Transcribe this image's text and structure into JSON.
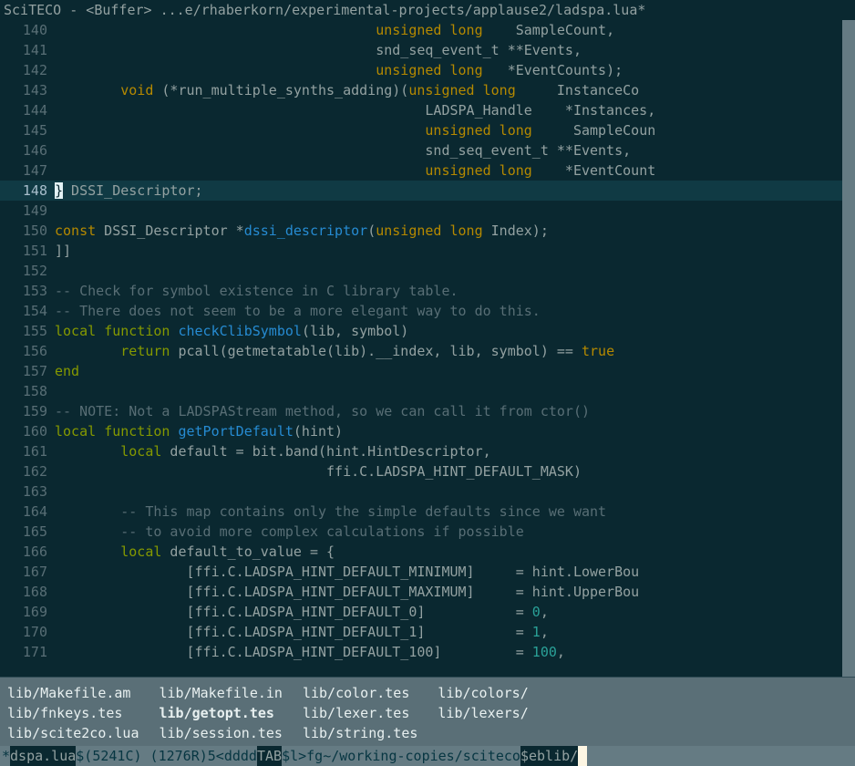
{
  "title": "SciTECO - <Buffer> ...e/rhaberkorn/experimental-projects/applause2/ladspa.lua*",
  "lines": [
    {
      "n": "140",
      "segs": [
        {
          "t": "                                       "
        },
        {
          "t": "unsigned",
          "c": "type"
        },
        {
          "t": " "
        },
        {
          "t": "long",
          "c": "type"
        },
        {
          "t": "    SampleCount,"
        }
      ]
    },
    {
      "n": "141",
      "segs": [
        {
          "t": "                                       snd_seq_event_t **Events,"
        }
      ]
    },
    {
      "n": "142",
      "segs": [
        {
          "t": "                                       "
        },
        {
          "t": "unsigned",
          "c": "type"
        },
        {
          "t": " "
        },
        {
          "t": "long",
          "c": "type"
        },
        {
          "t": "   *EventCounts);"
        }
      ]
    },
    {
      "n": "143",
      "segs": [
        {
          "t": "        "
        },
        {
          "t": "void",
          "c": "type"
        },
        {
          "t": " (*run_multiple_synths_adding)("
        },
        {
          "t": "unsigned",
          "c": "type"
        },
        {
          "t": " "
        },
        {
          "t": "long",
          "c": "type"
        },
        {
          "t": "     InstanceCo"
        }
      ]
    },
    {
      "n": "144",
      "segs": [
        {
          "t": "                                             LADSPA_Handle    *Instances,"
        }
      ]
    },
    {
      "n": "145",
      "segs": [
        {
          "t": "                                             "
        },
        {
          "t": "unsigned",
          "c": "type"
        },
        {
          "t": " "
        },
        {
          "t": "long",
          "c": "type"
        },
        {
          "t": "     SampleCoun"
        }
      ]
    },
    {
      "n": "146",
      "segs": [
        {
          "t": "                                             snd_seq_event_t **Events,"
        }
      ]
    },
    {
      "n": "147",
      "segs": [
        {
          "t": "                                             "
        },
        {
          "t": "unsigned",
          "c": "type"
        },
        {
          "t": " "
        },
        {
          "t": "long",
          "c": "type"
        },
        {
          "t": "    *EventCount"
        }
      ]
    },
    {
      "n": "148",
      "cur": true,
      "segs": [
        {
          "t": "}",
          "c": "cursor"
        },
        {
          "t": " DSSI_Descriptor;"
        }
      ]
    },
    {
      "n": "149",
      "segs": [
        {
          "t": ""
        }
      ]
    },
    {
      "n": "150",
      "segs": [
        {
          "t": "const",
          "c": "type"
        },
        {
          "t": " DSSI_Descriptor *"
        },
        {
          "t": "dssi_descriptor",
          "c": "func"
        },
        {
          "t": "("
        },
        {
          "t": "unsigned",
          "c": "type"
        },
        {
          "t": " "
        },
        {
          "t": "long",
          "c": "type"
        },
        {
          "t": " Index);"
        }
      ]
    },
    {
      "n": "151",
      "segs": [
        {
          "t": "]]"
        }
      ]
    },
    {
      "n": "152",
      "segs": [
        {
          "t": ""
        }
      ]
    },
    {
      "n": "153",
      "segs": [
        {
          "t": "-- Check for symbol existence in C library table.",
          "c": "comment"
        }
      ]
    },
    {
      "n": "154",
      "segs": [
        {
          "t": "-- There does not seem to be a more elegant way to do this.",
          "c": "comment"
        }
      ]
    },
    {
      "n": "155",
      "segs": [
        {
          "t": "local",
          "c": "kw"
        },
        {
          "t": " "
        },
        {
          "t": "function",
          "c": "kw"
        },
        {
          "t": " "
        },
        {
          "t": "checkClibSymbol",
          "c": "func"
        },
        {
          "t": "(lib, symbol)"
        }
      ]
    },
    {
      "n": "156",
      "segs": [
        {
          "t": "        "
        },
        {
          "t": "return",
          "c": "kw"
        },
        {
          "t": " pcall(getmetatable(lib).__index, lib, symbol) == "
        },
        {
          "t": "true",
          "c": "bool"
        }
      ]
    },
    {
      "n": "157",
      "segs": [
        {
          "t": "end",
          "c": "kw"
        }
      ]
    },
    {
      "n": "158",
      "segs": [
        {
          "t": ""
        }
      ]
    },
    {
      "n": "159",
      "segs": [
        {
          "t": "-- NOTE: Not a LADSPAStream method, so we can call it from ctor()",
          "c": "comment"
        }
      ]
    },
    {
      "n": "160",
      "segs": [
        {
          "t": "local",
          "c": "kw"
        },
        {
          "t": " "
        },
        {
          "t": "function",
          "c": "kw"
        },
        {
          "t": " "
        },
        {
          "t": "getPortDefault",
          "c": "func"
        },
        {
          "t": "(hint)"
        }
      ]
    },
    {
      "n": "161",
      "segs": [
        {
          "t": "        "
        },
        {
          "t": "local",
          "c": "kw"
        },
        {
          "t": " default = bit.band(hint.HintDescriptor,"
        }
      ]
    },
    {
      "n": "162",
      "segs": [
        {
          "t": "                                 ffi.C.LADSPA_HINT_DEFAULT_MASK)"
        }
      ]
    },
    {
      "n": "163",
      "segs": [
        {
          "t": ""
        }
      ]
    },
    {
      "n": "164",
      "segs": [
        {
          "t": "        "
        },
        {
          "t": "-- This map contains only the simple defaults since we want",
          "c": "comment"
        }
      ]
    },
    {
      "n": "165",
      "segs": [
        {
          "t": "        "
        },
        {
          "t": "-- to avoid more complex calculations if possible",
          "c": "comment"
        }
      ]
    },
    {
      "n": "166",
      "segs": [
        {
          "t": "        "
        },
        {
          "t": "local",
          "c": "kw"
        },
        {
          "t": " default_to_value = {"
        }
      ]
    },
    {
      "n": "167",
      "segs": [
        {
          "t": "                [ffi.C.LADSPA_HINT_DEFAULT_MINIMUM]     = hint.LowerBou"
        }
      ]
    },
    {
      "n": "168",
      "segs": [
        {
          "t": "                [ffi.C.LADSPA_HINT_DEFAULT_MAXIMUM]     = hint.UpperBou"
        }
      ]
    },
    {
      "n": "169",
      "segs": [
        {
          "t": "                [ffi.C.LADSPA_HINT_DEFAULT_0]           = "
        },
        {
          "t": "0",
          "c": "num"
        },
        {
          "t": ","
        }
      ]
    },
    {
      "n": "170",
      "segs": [
        {
          "t": "                [ffi.C.LADSPA_HINT_DEFAULT_1]           = "
        },
        {
          "t": "1",
          "c": "num"
        },
        {
          "t": ","
        }
      ]
    },
    {
      "n": "171",
      "segs": [
        {
          "t": "                [ffi.C.LADSPA_HINT_DEFAULT_100]         = "
        },
        {
          "t": "100",
          "c": "num"
        },
        {
          "t": ","
        }
      ]
    }
  ],
  "completion_cols": [
    [
      "lib/Makefile.am",
      "lib/fnkeys.tes",
      "lib/scite2co.lua"
    ],
    [
      "lib/Makefile.in",
      "lib/getopt.tes",
      "lib/session.tes"
    ],
    [
      "lib/color.tes",
      "lib/lexer.tes",
      "lib/string.tes"
    ],
    [
      "lib/colors/",
      "lib/lexers/",
      ""
    ]
  ],
  "completion_bold": "lib/getopt.tes",
  "status": {
    "prefix": "*",
    "file": "dspa.lua",
    "mid1": "$(5241C) (1276R)5<dddd",
    "tab": "TAB",
    "mid2": "$l>fg~/working-copies/sciteco",
    "eb": "$eblib/"
  }
}
